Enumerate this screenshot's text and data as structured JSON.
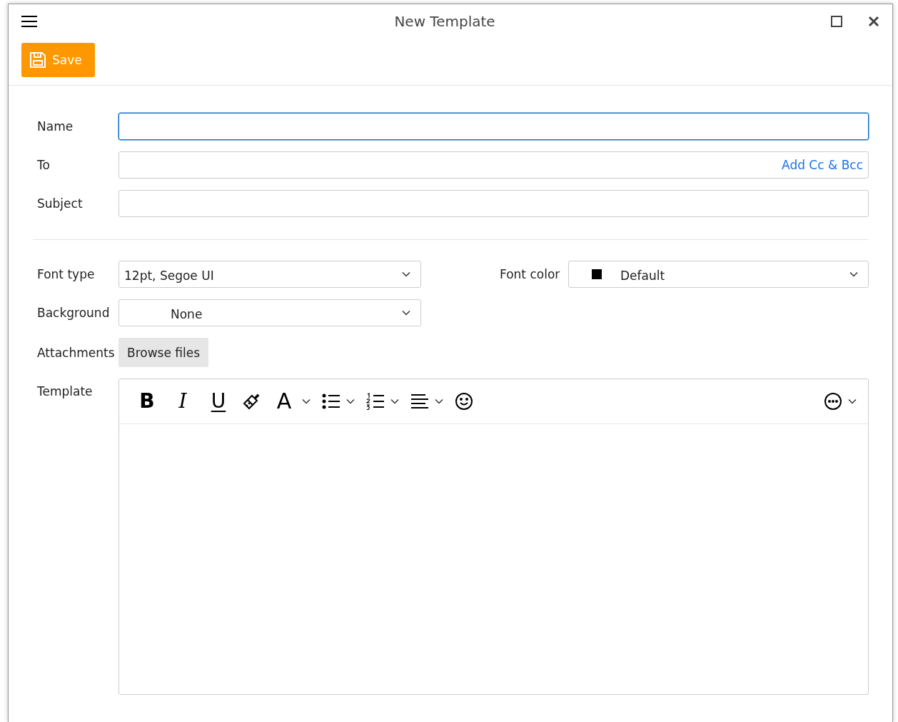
{
  "window": {
    "title": "New Template"
  },
  "toolbar": {
    "save_label": "Save"
  },
  "fields": [
    {
      "label": "Name",
      "focused": true
    },
    {
      "label": "To",
      "focused": false,
      "link": "Add Cc & Bcc"
    },
    {
      "label": "Subject",
      "focused": false
    }
  ],
  "font_type": {
    "label": "Font type",
    "value": "12pt, Segoe UI"
  },
  "font_color": {
    "label": "Font color",
    "value": "Default"
  },
  "background": {
    "label": "Background",
    "value": "None"
  },
  "attachments": {
    "label": "Attachments",
    "button": "Browse files"
  },
  "template": {
    "label": "Template",
    "tools": [
      {
        "kind": "bold",
        "glyph": "B",
        "dropdown": false
      },
      {
        "kind": "italic",
        "glyph": "I",
        "dropdown": false
      },
      {
        "kind": "underline",
        "glyph": "U",
        "dropdown": false
      },
      {
        "kind": "brush",
        "dropdown": false
      },
      {
        "kind": "font",
        "glyph": "A",
        "dropdown": true
      },
      {
        "kind": "bullets",
        "dropdown": true
      },
      {
        "kind": "numbers",
        "dropdown": true
      },
      {
        "kind": "align",
        "dropdown": true
      },
      {
        "kind": "emoji",
        "dropdown": false
      },
      {
        "kind": "more",
        "dropdown": true
      }
    ]
  }
}
